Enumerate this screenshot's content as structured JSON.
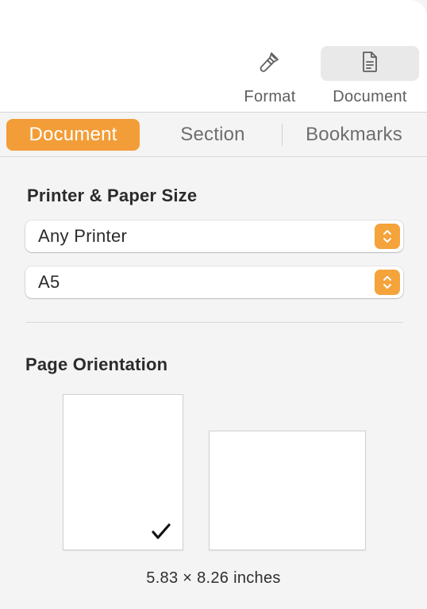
{
  "toolbar": {
    "format_label": "Format",
    "document_label": "Document",
    "format_icon": "paintbrush-icon",
    "document_icon": "document-icon"
  },
  "tabs": [
    {
      "label": "Document",
      "active": true
    },
    {
      "label": "Section",
      "active": false
    },
    {
      "label": "Bookmarks",
      "active": false
    }
  ],
  "printer_paper": {
    "heading": "Printer & Paper Size",
    "printer_value": "Any Printer",
    "paper_value": "A5"
  },
  "orientation": {
    "heading": "Page Orientation",
    "options": [
      "portrait",
      "landscape"
    ],
    "selected": "portrait",
    "dimensions": "5.83 × 8.26 inches"
  },
  "colors": {
    "accent": "#f39d38",
    "background": "#f4f4f4"
  }
}
